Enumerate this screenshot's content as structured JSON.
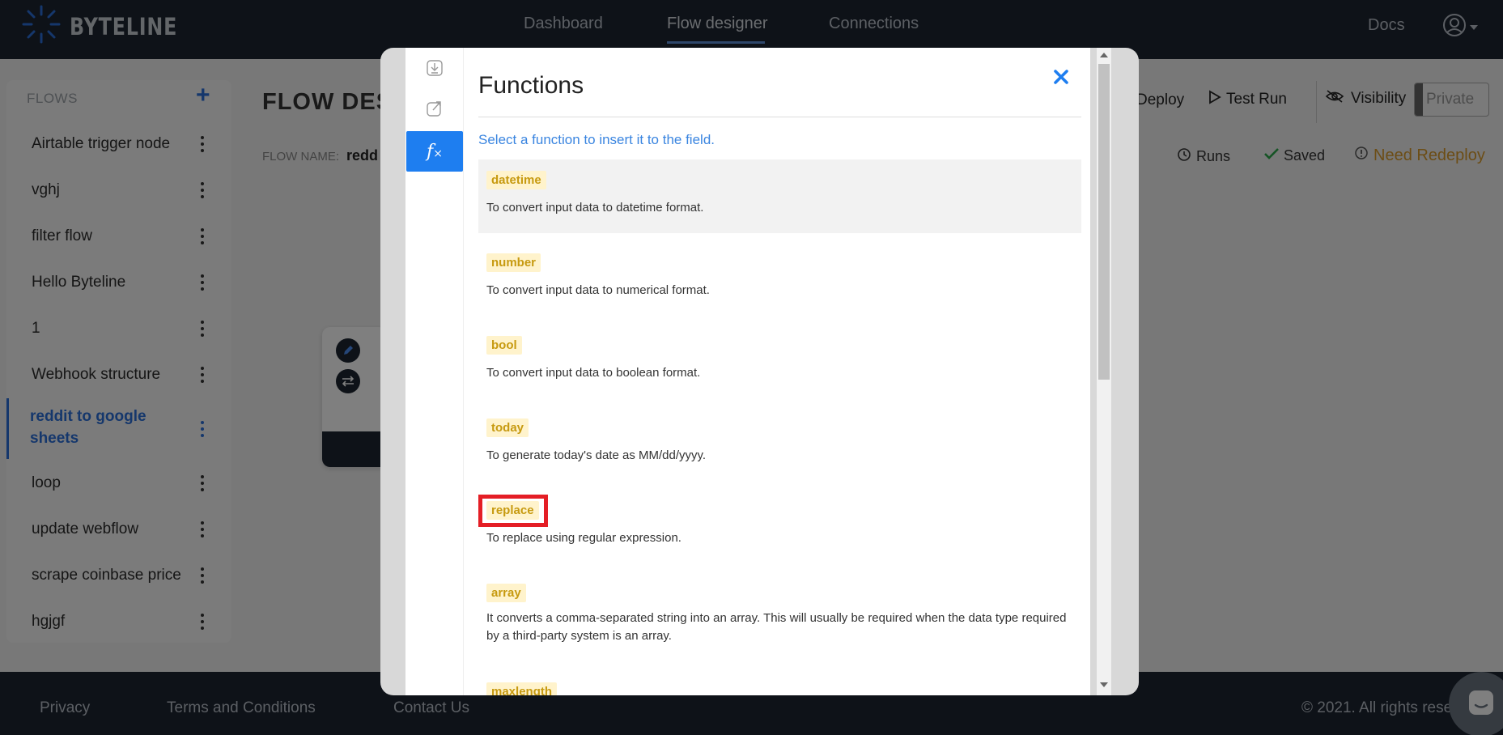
{
  "header": {
    "brand": "BYTELINE",
    "nav": [
      "Dashboard",
      "Flow designer",
      "Connections"
    ],
    "active_nav": "Flow designer",
    "docs": "Docs"
  },
  "sidebar": {
    "title": "FLOWS",
    "add": "+",
    "items": [
      {
        "label": "Airtable trigger node"
      },
      {
        "label": "vghj"
      },
      {
        "label": "filter flow"
      },
      {
        "label": "Hello Byteline"
      },
      {
        "label": "1"
      },
      {
        "label": "Webhook structure"
      },
      {
        "label": "reddit to google sheets"
      },
      {
        "label": "loop"
      },
      {
        "label": "update webflow"
      },
      {
        "label": "scrape coinbase price"
      },
      {
        "label": "hgjgf"
      }
    ],
    "active_index": 6
  },
  "main": {
    "title": "FLOW DES",
    "flow_name_label": "FLOW NAME:",
    "flow_name_value": "redd",
    "deploy": "Deploy",
    "test_run": "Test Run",
    "visibility": "Visibility",
    "private": "Private",
    "runs": "Runs",
    "saved": "Saved",
    "need_redeploy": "Need Redeploy"
  },
  "footer": {
    "privacy": "Privacy",
    "terms": "Terms and Conditions",
    "contact": "Contact Us",
    "copyright": "© 2021. All rights rese"
  },
  "modal": {
    "title": "Functions",
    "hint": "Select a function to insert it to the field.",
    "functions": [
      {
        "name": "datetime",
        "desc": "To convert input data to datetime format."
      },
      {
        "name": "number",
        "desc": "To convert input data to numerical format."
      },
      {
        "name": "bool",
        "desc": "To convert input data to boolean format."
      },
      {
        "name": "today",
        "desc": "To generate today's date as MM/dd/yyyy."
      },
      {
        "name": "replace",
        "desc": "To replace using regular expression."
      },
      {
        "name": "array",
        "desc": "It converts a comma-separated string into an array. This will usually be required when the data type required by a third-party system is an array."
      },
      {
        "name": "maxlength",
        "desc": ""
      }
    ],
    "highlighted_function": "replace"
  },
  "colors": {
    "header_bg": "#1c2530",
    "accent_blue": "#1e7ef0",
    "function_tag_bg": "#fff3cc",
    "function_tag_text": "#c79a10",
    "highlight_red": "#e41e25",
    "redeploy_orange": "#d99a2b"
  }
}
